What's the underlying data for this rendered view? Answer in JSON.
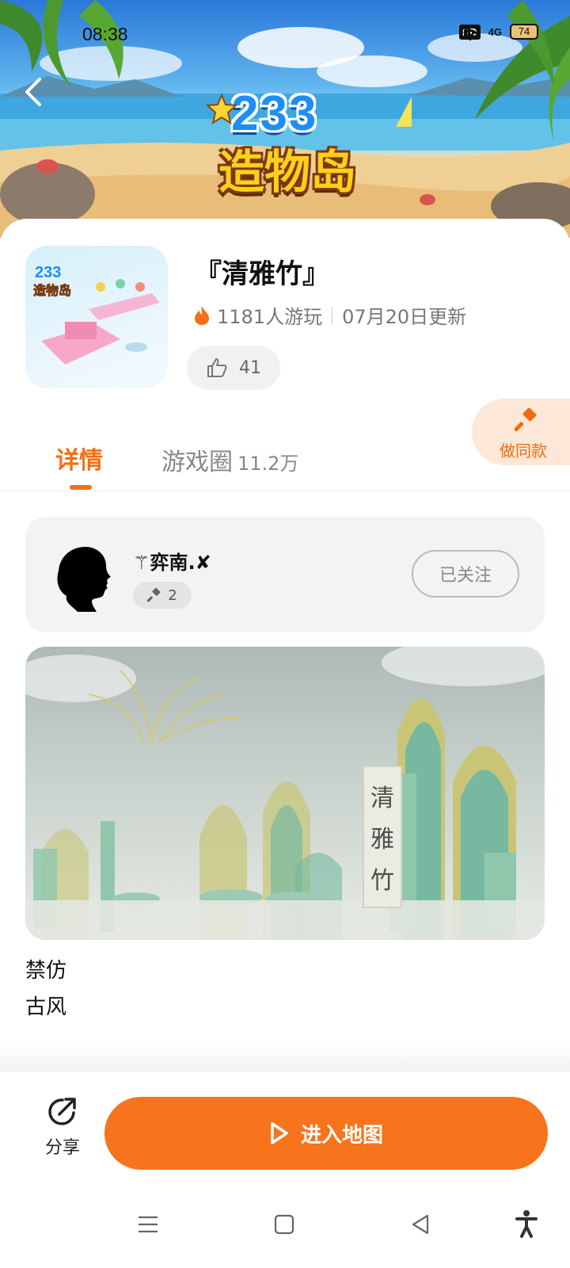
{
  "status_bar": {
    "time": "08:38",
    "hd_label": "HD",
    "network_label": "4G",
    "battery_level": "74"
  },
  "banner": {
    "logo_number": "233",
    "logo_text": "造物岛"
  },
  "map": {
    "title": "『清雅竹』",
    "players": "1181人游玩",
    "updated": "07月20日更新",
    "likes": "41"
  },
  "make_same": {
    "label": "做同款"
  },
  "tabs": {
    "detail": "详情",
    "circle": "游戏圈",
    "circle_count": "11.2万"
  },
  "creator": {
    "name": "⚚弈南.✘",
    "works": "2",
    "follow_label": "已关注"
  },
  "preview": {
    "scroll_chars": [
      "清",
      "雅",
      "竹"
    ]
  },
  "tags": [
    "禁仿",
    "古风"
  ],
  "bottom_bar": {
    "share_label": "分享",
    "enter_label": "进入地图"
  },
  "colors": {
    "accent": "#f7741c",
    "tab_active": "#f26f12",
    "make_same_bg": "#fde7d6"
  },
  "icons": [
    "back-arrow-icon",
    "flame-icon",
    "thumbs-up-icon",
    "hammer-icon",
    "share-icon",
    "play-icon",
    "menu-icon",
    "home-square-icon",
    "back-triangle-icon",
    "accessibility-icon"
  ]
}
